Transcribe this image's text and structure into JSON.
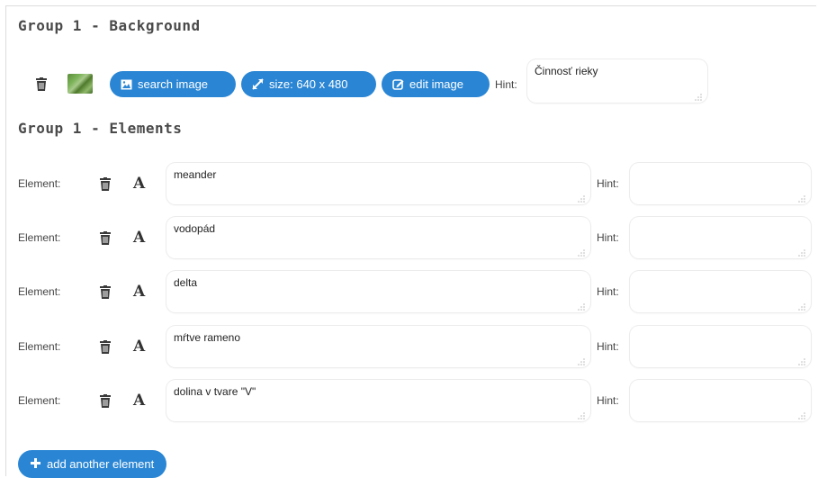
{
  "background_group": {
    "title": "Group 1 - Background",
    "buttons": {
      "search": "search image",
      "size": "size: 640 x 480",
      "edit": "edit image"
    },
    "hint_label": "Hint:",
    "hint_value": "Činnosť rieky"
  },
  "elements_group": {
    "title": "Group 1 - Elements",
    "element_label": "Element:",
    "hint_label": "Hint:",
    "font_glyph": "A",
    "elements": [
      {
        "value": "meander",
        "hint": ""
      },
      {
        "value": "vodopád",
        "hint": ""
      },
      {
        "value": "delta",
        "hint": ""
      },
      {
        "value": "mŕtve rameno",
        "hint": ""
      },
      {
        "value": "dolina v tvare \"V\"",
        "hint": ""
      }
    ]
  },
  "add_button": {
    "label": "add another element"
  },
  "colors": {
    "accent": "#2a86d4",
    "title": "#4a4a4a"
  }
}
